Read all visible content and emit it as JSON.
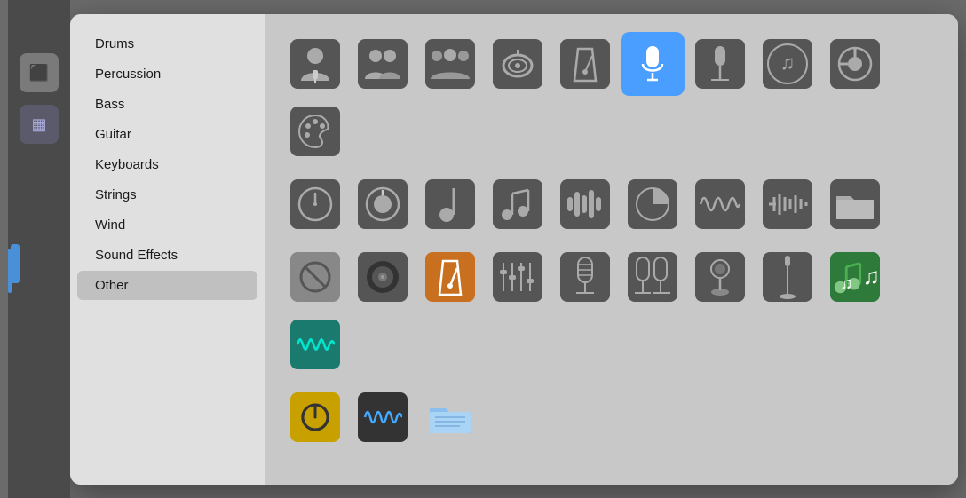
{
  "sidebar": {
    "items": [
      {
        "id": "drums",
        "label": "Drums",
        "active": false
      },
      {
        "id": "percussion",
        "label": "Percussion",
        "active": false
      },
      {
        "id": "bass",
        "label": "Bass",
        "active": false
      },
      {
        "id": "guitar",
        "label": "Guitar",
        "active": false
      },
      {
        "id": "keyboards",
        "label": "Keyboards",
        "active": false
      },
      {
        "id": "strings",
        "label": "Strings",
        "active": false
      },
      {
        "id": "wind",
        "label": "Wind",
        "active": false
      },
      {
        "id": "sound-effects",
        "label": "Sound Effects",
        "active": false
      },
      {
        "id": "other",
        "label": "Other",
        "active": true
      }
    ]
  },
  "grid": {
    "row1": [
      {
        "icon": "👤",
        "name": "person-icon",
        "selected": false
      },
      {
        "icon": "👥",
        "name": "duo-person-icon",
        "selected": false
      },
      {
        "icon": "👨‍👩‍👧",
        "name": "group-icon",
        "selected": false
      },
      {
        "icon": "🔔",
        "name": "bell-icon",
        "selected": false
      },
      {
        "icon": "🎵",
        "name": "metronome-icon",
        "selected": false
      },
      {
        "icon": "🎤",
        "name": "mic-white-icon",
        "selected": true
      },
      {
        "icon": "🎙",
        "name": "mic-stand-icon",
        "selected": false
      },
      {
        "icon": "🎵",
        "name": "music-note-icon",
        "selected": false
      },
      {
        "icon": "🔌",
        "name": "plugin-icon",
        "selected": false
      },
      {
        "icon": "🎨",
        "name": "palette-icon",
        "selected": false
      }
    ],
    "row2": [
      {
        "icon": "⏱",
        "name": "clock-icon",
        "selected": false
      },
      {
        "icon": "🎛",
        "name": "knob-icon",
        "selected": false
      },
      {
        "icon": "🎵",
        "name": "note-icon",
        "selected": false
      },
      {
        "icon": "🎵",
        "name": "music-icon",
        "selected": false
      },
      {
        "icon": "📊",
        "name": "waveform-icon",
        "selected": false
      },
      {
        "icon": "⏱",
        "name": "timer-icon",
        "selected": false
      },
      {
        "icon": "〰",
        "name": "wave-icon",
        "selected": false
      },
      {
        "icon": "📶",
        "name": "signal-icon",
        "selected": false
      },
      {
        "icon": "📁",
        "name": "folder-icon",
        "selected": false
      }
    ],
    "row3": [
      {
        "icon": "🚫",
        "name": "no-icon",
        "selected": false
      },
      {
        "icon": "🔊",
        "name": "speaker-icon",
        "selected": false
      },
      {
        "icon": "📯",
        "name": "metronome2-icon",
        "selected": false
      },
      {
        "icon": "🎚",
        "name": "mixer-icon",
        "selected": false
      },
      {
        "icon": "🎙",
        "name": "condenser-mic-icon",
        "selected": false
      },
      {
        "icon": "🎙",
        "name": "dual-mic-icon",
        "selected": false
      },
      {
        "icon": "🎙",
        "name": "desk-mic-icon",
        "selected": false
      },
      {
        "icon": "🎙",
        "name": "tall-mic-icon",
        "selected": false
      },
      {
        "icon": "🎵",
        "name": "green-music-icon",
        "selected": false
      },
      {
        "icon": "〰",
        "name": "teal-wave-icon",
        "selected": false
      }
    ],
    "row4": [
      {
        "icon": "⏺",
        "name": "record-icon",
        "selected": false
      },
      {
        "icon": "〰",
        "name": "waveform2-icon",
        "selected": false
      },
      {
        "icon": "📂",
        "name": "open-folder-icon",
        "selected": false
      }
    ]
  }
}
